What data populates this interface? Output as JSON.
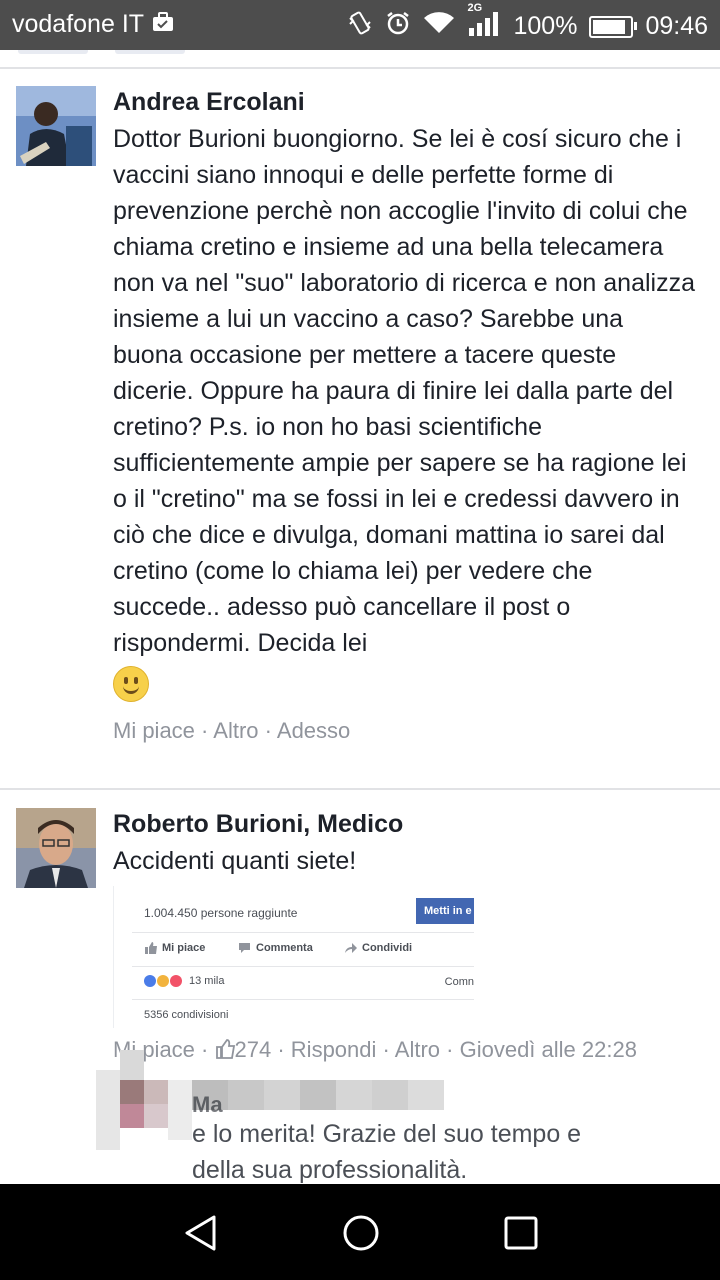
{
  "status_bar": {
    "carrier": "vodafone IT",
    "network": "2G",
    "battery": "100%",
    "battery_level": 1.0,
    "time": "09:46",
    "icons": [
      "briefcase-icon",
      "vibrate-icon",
      "alarm-icon",
      "wifi-icon",
      "signal-icon",
      "battery-icon"
    ]
  },
  "comments": [
    {
      "author": "Andrea Ercolani",
      "text": "Dottor Burioni buongiorno. Se lei è cosí sicuro che i vaccini siano innoqui e delle perfette forme di prevenzione perchè non accoglie l'invito di colui che chiama cretino e insieme ad una bella telecamera non va nel \"suo\" laboratorio di ricerca e non analizza insieme a lui un vaccino a caso? Sarebbe una buona occasione per mettere a tacere queste dicerie. Oppure ha paura di finire lei dalla parte del cretino? P.s. io non ho basi scientifiche sufficientemente ampie per sapere se ha ragione lei o il \"cretino\" ma se fossi in lei e credessi davvero in ciò che dice e divulga, domani mattina io sarei dal cretino (come lo chiama lei) per vedere che succede.. adesso può cancellare il post o rispondermi. Decida lei",
      "emoji": "smile-emoji",
      "like_label": "Mi piace",
      "more_label": "Altro",
      "time": "Adesso",
      "sep": "·"
    },
    {
      "author": "Roberto Burioni, Medico",
      "text": "Accidenti quanti siete!",
      "like_label": "Mi piace",
      "likes_count": "274",
      "reply_label": "Rispondi",
      "more_label": "Altro",
      "time": "Giovedì alle 22:28",
      "sep": "·",
      "screenshot": {
        "reach": "1.004.450 persone raggiunte",
        "boost_button": "Metti in e",
        "like": "Mi piace",
        "comment": "Commenta",
        "share": "Condividi",
        "reactions_count": "13 mila",
        "comments_cut": "Comn",
        "shares": "5356 condivisioni"
      }
    }
  ],
  "reply_preview": {
    "author_fragment": "Ma",
    "line1": "e lo merita! Grazie del suo tempo e",
    "line2": "della sua professionalità."
  },
  "nav": [
    "back-icon",
    "home-icon",
    "recents-icon"
  ],
  "colors": {
    "status_bar": "#4d4d4d",
    "text": "#1d2129",
    "meta": "#90949c",
    "link_blue": "#4267b2"
  }
}
